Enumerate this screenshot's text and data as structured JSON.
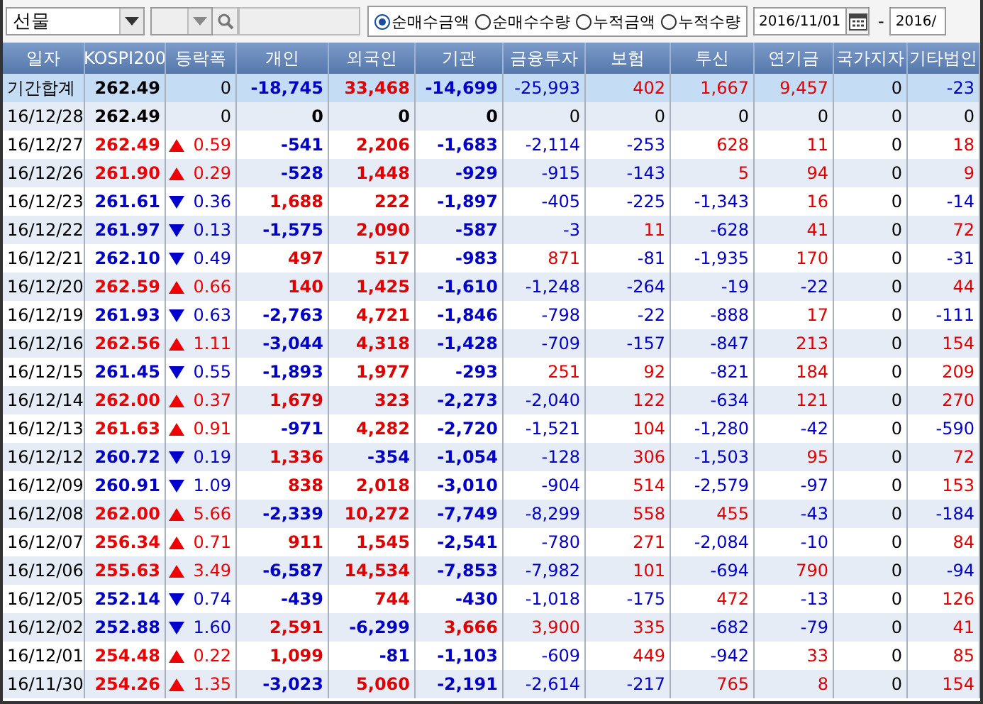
{
  "toolbar": {
    "market": "선물",
    "modes": [
      {
        "label": "순매수금액",
        "selected": true
      },
      {
        "label": "순매수수량",
        "selected": false
      },
      {
        "label": "누적금액",
        "selected": false
      },
      {
        "label": "누적수량",
        "selected": false
      }
    ],
    "date_from": "2016/11/01",
    "date_separator": "-",
    "date_to": "2016/"
  },
  "table": {
    "columns": [
      "일자",
      "KOSPI200",
      "등락폭",
      "개인",
      "외국인",
      "기관",
      "금융투자",
      "보험",
      "투신",
      "연기금",
      "국가지자",
      "기타법인"
    ],
    "rows": [
      {
        "date": "기간합계",
        "selected": true,
        "kospi": "262.49",
        "kind": "flat",
        "change": "0",
        "investors": [
          {
            "value": "-18,745",
            "color": "#0000c8"
          },
          {
            "value": "33,468",
            "color": "#e00000"
          },
          {
            "value": "-14,699",
            "color": "#0000c8"
          },
          {
            "value": "-25,993",
            "color": "#0000c8"
          },
          {
            "value": "402",
            "color": "#e00000"
          },
          {
            "value": "1,667",
            "color": "#e00000"
          },
          {
            "value": "9,457",
            "color": "#e00000"
          },
          {
            "value": "0",
            "color": "#000000"
          },
          {
            "value": "-23",
            "color": "#0000c8"
          }
        ]
      },
      {
        "date": "16/12/28",
        "selected": false,
        "kospi": "262.49",
        "kind": "flat",
        "change": "0",
        "investors": [
          {
            "value": "0",
            "color": "#000000"
          },
          {
            "value": "0",
            "color": "#000000"
          },
          {
            "value": "0",
            "color": "#000000"
          },
          {
            "value": "0",
            "color": "#000000"
          },
          {
            "value": "0",
            "color": "#000000"
          },
          {
            "value": "0",
            "color": "#000000"
          },
          {
            "value": "0",
            "color": "#000000"
          },
          {
            "value": "0",
            "color": "#000000"
          },
          {
            "value": "0",
            "color": "#000000"
          }
        ]
      },
      {
        "date": "16/12/27",
        "selected": false,
        "kospi": "262.49",
        "kind": "up",
        "change": "0.59",
        "investors": [
          {
            "value": "-541",
            "color": "#0000c8"
          },
          {
            "value": "2,206",
            "color": "#e00000"
          },
          {
            "value": "-1,683",
            "color": "#0000c8"
          },
          {
            "value": "-2,114",
            "color": "#0000c8"
          },
          {
            "value": "-253",
            "color": "#0000c8"
          },
          {
            "value": "628",
            "color": "#e00000"
          },
          {
            "value": "11",
            "color": "#e00000"
          },
          {
            "value": "0",
            "color": "#000000"
          },
          {
            "value": "18",
            "color": "#e00000"
          }
        ]
      },
      {
        "date": "16/12/26",
        "selected": false,
        "kospi": "261.90",
        "kind": "up",
        "change": "0.29",
        "investors": [
          {
            "value": "-528",
            "color": "#0000c8"
          },
          {
            "value": "1,448",
            "color": "#e00000"
          },
          {
            "value": "-929",
            "color": "#0000c8"
          },
          {
            "value": "-915",
            "color": "#0000c8"
          },
          {
            "value": "-143",
            "color": "#0000c8"
          },
          {
            "value": "5",
            "color": "#e00000"
          },
          {
            "value": "94",
            "color": "#e00000"
          },
          {
            "value": "0",
            "color": "#000000"
          },
          {
            "value": "9",
            "color": "#e00000"
          }
        ]
      },
      {
        "date": "16/12/23",
        "selected": false,
        "kospi": "261.61",
        "kind": "down",
        "change": "0.36",
        "investors": [
          {
            "value": "1,688",
            "color": "#e00000"
          },
          {
            "value": "222",
            "color": "#e00000"
          },
          {
            "value": "-1,897",
            "color": "#0000c8"
          },
          {
            "value": "-405",
            "color": "#0000c8"
          },
          {
            "value": "-225",
            "color": "#0000c8"
          },
          {
            "value": "-1,343",
            "color": "#0000c8"
          },
          {
            "value": "16",
            "color": "#e00000"
          },
          {
            "value": "0",
            "color": "#000000"
          },
          {
            "value": "-14",
            "color": "#0000c8"
          }
        ]
      },
      {
        "date": "16/12/22",
        "selected": false,
        "kospi": "261.97",
        "kind": "down",
        "change": "0.13",
        "investors": [
          {
            "value": "-1,575",
            "color": "#0000c8"
          },
          {
            "value": "2,090",
            "color": "#e00000"
          },
          {
            "value": "-587",
            "color": "#0000c8"
          },
          {
            "value": "-3",
            "color": "#0000c8"
          },
          {
            "value": "11",
            "color": "#e00000"
          },
          {
            "value": "-628",
            "color": "#0000c8"
          },
          {
            "value": "41",
            "color": "#e00000"
          },
          {
            "value": "0",
            "color": "#000000"
          },
          {
            "value": "72",
            "color": "#e00000"
          }
        ]
      },
      {
        "date": "16/12/21",
        "selected": false,
        "kospi": "262.10",
        "kind": "down",
        "change": "0.49",
        "investors": [
          {
            "value": "497",
            "color": "#e00000"
          },
          {
            "value": "517",
            "color": "#e00000"
          },
          {
            "value": "-983",
            "color": "#0000c8"
          },
          {
            "value": "871",
            "color": "#e00000"
          },
          {
            "value": "-81",
            "color": "#0000c8"
          },
          {
            "value": "-1,935",
            "color": "#0000c8"
          },
          {
            "value": "170",
            "color": "#e00000"
          },
          {
            "value": "0",
            "color": "#000000"
          },
          {
            "value": "-31",
            "color": "#0000c8"
          }
        ]
      },
      {
        "date": "16/12/20",
        "selected": false,
        "kospi": "262.59",
        "kind": "up",
        "change": "0.66",
        "investors": [
          {
            "value": "140",
            "color": "#e00000"
          },
          {
            "value": "1,425",
            "color": "#e00000"
          },
          {
            "value": "-1,610",
            "color": "#0000c8"
          },
          {
            "value": "-1,248",
            "color": "#0000c8"
          },
          {
            "value": "-264",
            "color": "#0000c8"
          },
          {
            "value": "-19",
            "color": "#0000c8"
          },
          {
            "value": "-22",
            "color": "#0000c8"
          },
          {
            "value": "0",
            "color": "#000000"
          },
          {
            "value": "44",
            "color": "#e00000"
          }
        ]
      },
      {
        "date": "16/12/19",
        "selected": false,
        "kospi": "261.93",
        "kind": "down",
        "change": "0.63",
        "investors": [
          {
            "value": "-2,763",
            "color": "#0000c8"
          },
          {
            "value": "4,721",
            "color": "#e00000"
          },
          {
            "value": "-1,846",
            "color": "#0000c8"
          },
          {
            "value": "-798",
            "color": "#0000c8"
          },
          {
            "value": "-22",
            "color": "#0000c8"
          },
          {
            "value": "-888",
            "color": "#0000c8"
          },
          {
            "value": "17",
            "color": "#e00000"
          },
          {
            "value": "0",
            "color": "#000000"
          },
          {
            "value": "-111",
            "color": "#0000c8"
          }
        ]
      },
      {
        "date": "16/12/16",
        "selected": false,
        "kospi": "262.56",
        "kind": "up",
        "change": "1.11",
        "investors": [
          {
            "value": "-3,044",
            "color": "#0000c8"
          },
          {
            "value": "4,318",
            "color": "#e00000"
          },
          {
            "value": "-1,428",
            "color": "#0000c8"
          },
          {
            "value": "-709",
            "color": "#0000c8"
          },
          {
            "value": "-157",
            "color": "#0000c8"
          },
          {
            "value": "-847",
            "color": "#0000c8"
          },
          {
            "value": "213",
            "color": "#e00000"
          },
          {
            "value": "0",
            "color": "#000000"
          },
          {
            "value": "154",
            "color": "#e00000"
          }
        ]
      },
      {
        "date": "16/12/15",
        "selected": false,
        "kospi": "261.45",
        "kind": "down",
        "change": "0.55",
        "investors": [
          {
            "value": "-1,893",
            "color": "#0000c8"
          },
          {
            "value": "1,977",
            "color": "#e00000"
          },
          {
            "value": "-293",
            "color": "#0000c8"
          },
          {
            "value": "251",
            "color": "#e00000"
          },
          {
            "value": "92",
            "color": "#e00000"
          },
          {
            "value": "-821",
            "color": "#0000c8"
          },
          {
            "value": "184",
            "color": "#e00000"
          },
          {
            "value": "0",
            "color": "#000000"
          },
          {
            "value": "209",
            "color": "#e00000"
          }
        ]
      },
      {
        "date": "16/12/14",
        "selected": false,
        "kospi": "262.00",
        "kind": "up",
        "change": "0.37",
        "investors": [
          {
            "value": "1,679",
            "color": "#e00000"
          },
          {
            "value": "323",
            "color": "#e00000"
          },
          {
            "value": "-2,273",
            "color": "#0000c8"
          },
          {
            "value": "-2,040",
            "color": "#0000c8"
          },
          {
            "value": "122",
            "color": "#e00000"
          },
          {
            "value": "-634",
            "color": "#0000c8"
          },
          {
            "value": "121",
            "color": "#e00000"
          },
          {
            "value": "0",
            "color": "#000000"
          },
          {
            "value": "270",
            "color": "#e00000"
          }
        ]
      },
      {
        "date": "16/12/13",
        "selected": false,
        "kospi": "261.63",
        "kind": "up",
        "change": "0.91",
        "investors": [
          {
            "value": "-971",
            "color": "#0000c8"
          },
          {
            "value": "4,282",
            "color": "#e00000"
          },
          {
            "value": "-2,720",
            "color": "#0000c8"
          },
          {
            "value": "-1,521",
            "color": "#0000c8"
          },
          {
            "value": "104",
            "color": "#e00000"
          },
          {
            "value": "-1,280",
            "color": "#0000c8"
          },
          {
            "value": "-42",
            "color": "#0000c8"
          },
          {
            "value": "0",
            "color": "#000000"
          },
          {
            "value": "-590",
            "color": "#0000c8"
          }
        ]
      },
      {
        "date": "16/12/12",
        "selected": false,
        "kospi": "260.72",
        "kind": "down",
        "change": "0.19",
        "investors": [
          {
            "value": "1,336",
            "color": "#e00000"
          },
          {
            "value": "-354",
            "color": "#0000c8"
          },
          {
            "value": "-1,054",
            "color": "#0000c8"
          },
          {
            "value": "-128",
            "color": "#0000c8"
          },
          {
            "value": "306",
            "color": "#e00000"
          },
          {
            "value": "-1,503",
            "color": "#0000c8"
          },
          {
            "value": "95",
            "color": "#e00000"
          },
          {
            "value": "0",
            "color": "#000000"
          },
          {
            "value": "72",
            "color": "#e00000"
          }
        ]
      },
      {
        "date": "16/12/09",
        "selected": false,
        "kospi": "260.91",
        "kind": "down",
        "change": "1.09",
        "investors": [
          {
            "value": "838",
            "color": "#e00000"
          },
          {
            "value": "2,018",
            "color": "#e00000"
          },
          {
            "value": "-3,010",
            "color": "#0000c8"
          },
          {
            "value": "-904",
            "color": "#0000c8"
          },
          {
            "value": "514",
            "color": "#e00000"
          },
          {
            "value": "-2,579",
            "color": "#0000c8"
          },
          {
            "value": "-97",
            "color": "#0000c8"
          },
          {
            "value": "0",
            "color": "#000000"
          },
          {
            "value": "153",
            "color": "#e00000"
          }
        ]
      },
      {
        "date": "16/12/08",
        "selected": false,
        "kospi": "262.00",
        "kind": "up",
        "change": "5.66",
        "investors": [
          {
            "value": "-2,339",
            "color": "#0000c8"
          },
          {
            "value": "10,272",
            "color": "#e00000"
          },
          {
            "value": "-7,749",
            "color": "#0000c8"
          },
          {
            "value": "-8,299",
            "color": "#0000c8"
          },
          {
            "value": "558",
            "color": "#e00000"
          },
          {
            "value": "455",
            "color": "#e00000"
          },
          {
            "value": "-43",
            "color": "#0000c8"
          },
          {
            "value": "0",
            "color": "#000000"
          },
          {
            "value": "-184",
            "color": "#0000c8"
          }
        ]
      },
      {
        "date": "16/12/07",
        "selected": false,
        "kospi": "256.34",
        "kind": "up",
        "change": "0.71",
        "investors": [
          {
            "value": "911",
            "color": "#e00000"
          },
          {
            "value": "1,545",
            "color": "#e00000"
          },
          {
            "value": "-2,541",
            "color": "#0000c8"
          },
          {
            "value": "-780",
            "color": "#0000c8"
          },
          {
            "value": "271",
            "color": "#e00000"
          },
          {
            "value": "-2,084",
            "color": "#0000c8"
          },
          {
            "value": "-10",
            "color": "#0000c8"
          },
          {
            "value": "0",
            "color": "#000000"
          },
          {
            "value": "84",
            "color": "#e00000"
          }
        ]
      },
      {
        "date": "16/12/06",
        "selected": false,
        "kospi": "255.63",
        "kind": "up",
        "change": "3.49",
        "investors": [
          {
            "value": "-6,587",
            "color": "#0000c8"
          },
          {
            "value": "14,534",
            "color": "#e00000"
          },
          {
            "value": "-7,853",
            "color": "#0000c8"
          },
          {
            "value": "-7,982",
            "color": "#0000c8"
          },
          {
            "value": "101",
            "color": "#e00000"
          },
          {
            "value": "-694",
            "color": "#0000c8"
          },
          {
            "value": "790",
            "color": "#e00000"
          },
          {
            "value": "0",
            "color": "#000000"
          },
          {
            "value": "-94",
            "color": "#0000c8"
          }
        ]
      },
      {
        "date": "16/12/05",
        "selected": false,
        "kospi": "252.14",
        "kind": "down",
        "change": "0.74",
        "investors": [
          {
            "value": "-439",
            "color": "#0000c8"
          },
          {
            "value": "744",
            "color": "#e00000"
          },
          {
            "value": "-430",
            "color": "#0000c8"
          },
          {
            "value": "-1,018",
            "color": "#0000c8"
          },
          {
            "value": "-175",
            "color": "#0000c8"
          },
          {
            "value": "472",
            "color": "#e00000"
          },
          {
            "value": "-13",
            "color": "#0000c8"
          },
          {
            "value": "0",
            "color": "#000000"
          },
          {
            "value": "126",
            "color": "#e00000"
          }
        ]
      },
      {
        "date": "16/12/02",
        "selected": false,
        "kospi": "252.88",
        "kind": "down",
        "change": "1.60",
        "investors": [
          {
            "value": "2,591",
            "color": "#e00000"
          },
          {
            "value": "-6,299",
            "color": "#0000c8"
          },
          {
            "value": "3,666",
            "color": "#e00000"
          },
          {
            "value": "3,900",
            "color": "#e00000"
          },
          {
            "value": "335",
            "color": "#e00000"
          },
          {
            "value": "-682",
            "color": "#0000c8"
          },
          {
            "value": "-79",
            "color": "#0000c8"
          },
          {
            "value": "0",
            "color": "#000000"
          },
          {
            "value": "41",
            "color": "#e00000"
          }
        ]
      },
      {
        "date": "16/12/01",
        "selected": false,
        "kospi": "254.48",
        "kind": "up",
        "change": "0.22",
        "investors": [
          {
            "value": "1,099",
            "color": "#e00000"
          },
          {
            "value": "-81",
            "color": "#0000c8"
          },
          {
            "value": "-1,103",
            "color": "#0000c8"
          },
          {
            "value": "-609",
            "color": "#0000c8"
          },
          {
            "value": "449",
            "color": "#e00000"
          },
          {
            "value": "-942",
            "color": "#0000c8"
          },
          {
            "value": "33",
            "color": "#e00000"
          },
          {
            "value": "0",
            "color": "#000000"
          },
          {
            "value": "85",
            "color": "#e00000"
          }
        ]
      },
      {
        "date": "16/11/30",
        "selected": false,
        "kospi": "254.26",
        "kind": "up",
        "change": "1.35",
        "investors": [
          {
            "value": "-3,023",
            "color": "#0000c8"
          },
          {
            "value": "5,060",
            "color": "#e00000"
          },
          {
            "value": "-2,191",
            "color": "#0000c8"
          },
          {
            "value": "-2,614",
            "color": "#0000c8"
          },
          {
            "value": "-217",
            "color": "#0000c8"
          },
          {
            "value": "765",
            "color": "#e00000"
          },
          {
            "value": "8",
            "color": "#e00000"
          },
          {
            "value": "0",
            "color": "#000000"
          },
          {
            "value": "154",
            "color": "#e00000"
          }
        ]
      }
    ]
  }
}
